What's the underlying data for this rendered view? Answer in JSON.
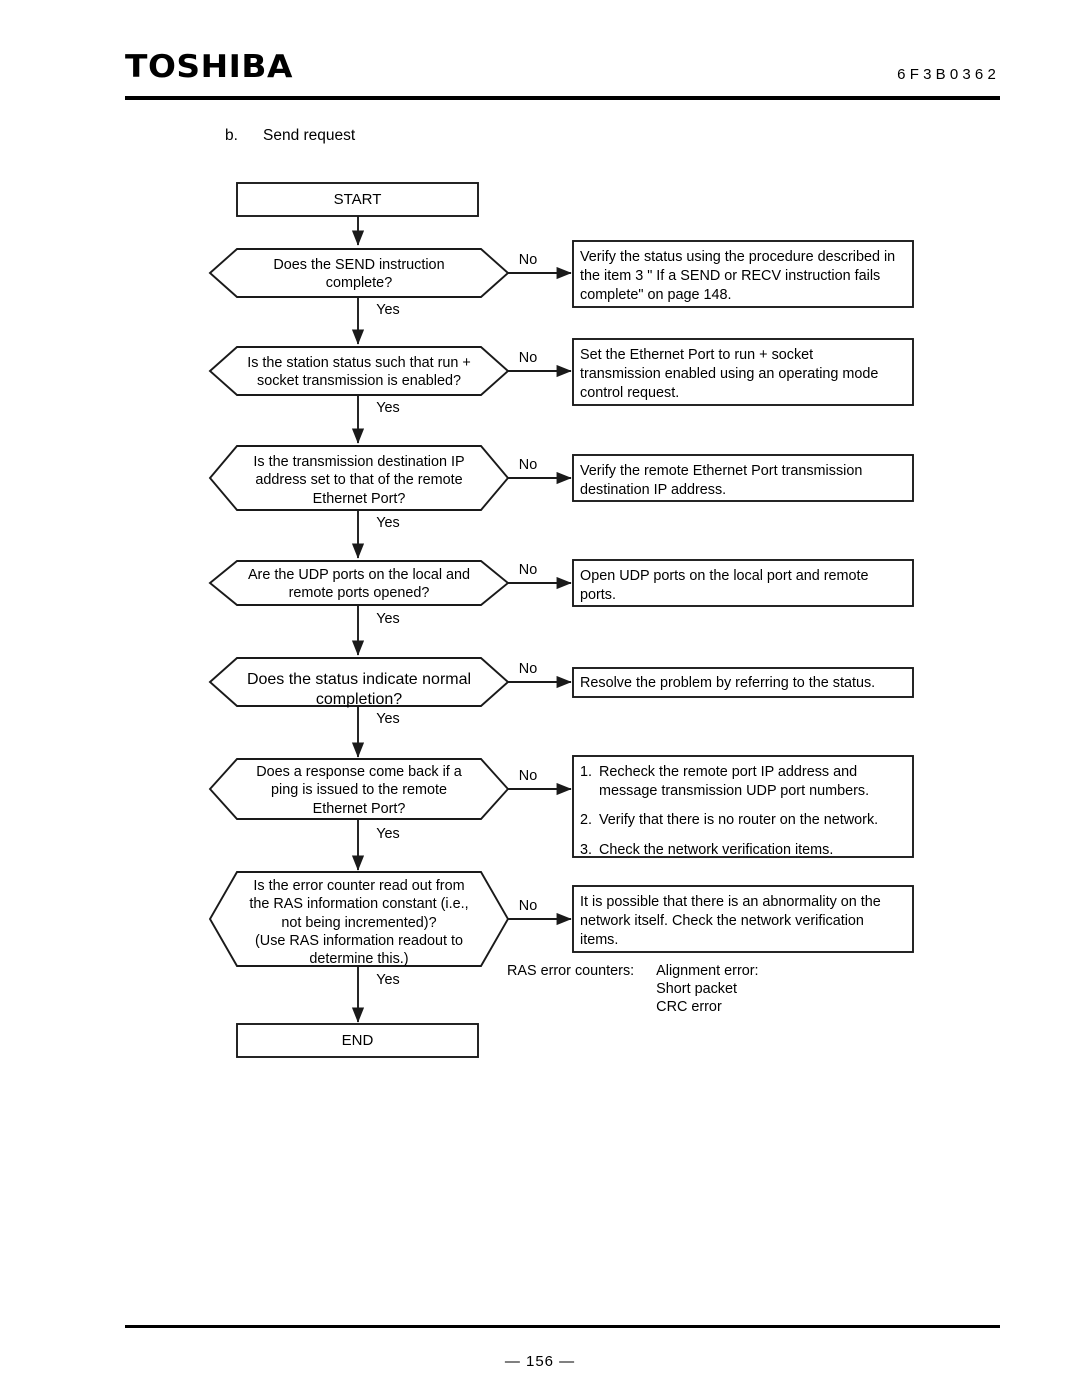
{
  "header": {
    "brand": "TOSHIBA",
    "doc_number": "6F3B0362"
  },
  "footer": {
    "page_number": "— 156 —"
  },
  "section": {
    "label": "b.",
    "title": "Send request"
  },
  "flowchart": {
    "type": "flowchart",
    "start_label": "START",
    "end_label": "END",
    "yes_label": "Yes",
    "no_label": "No",
    "steps": [
      {
        "question": "Does the SEND instruction\ncomplete?",
        "no_action": "Verify the status using the procedure described in\nthe item 3 \" If a SEND or RECV instruction fails\ncomplete\" on page 148."
      },
      {
        "question": "Is the station status such that run +\nsocket transmission is enabled?",
        "no_action": "Set the Ethernet Port to run + socket\ntransmission enabled using an operating mode\ncontrol request."
      },
      {
        "question": "Is the transmission destination IP\naddress set to that of the remote\nEthernet Port?",
        "no_action": "Verify the remote Ethernet Port transmission\ndestination IP address."
      },
      {
        "question": "Are the UDP ports on the local and\nremote ports opened?",
        "no_action": "Open UDP ports on the local port and remote\nports."
      },
      {
        "question": "Does the status indicate normal\ncompletion?",
        "no_action": "Resolve the problem by referring to the status."
      },
      {
        "question": "Does a response come back if a\nping is issued to the remote\nEthernet Port?",
        "no_action_list": [
          {
            "num": "1.",
            "text": "Recheck the remote port IP address and\nmessage transmission UDP port numbers."
          },
          {
            "num": "2.",
            "text": "Verify that there is no router on the network."
          },
          {
            "num": "3.",
            "text": "Check the network verification items."
          }
        ]
      },
      {
        "question": "Is the error counter read out from\nthe RAS information constant (i.e.,\nnot being incremented)?\n(Use RAS information readout to\ndetermine this.)",
        "no_action": "It is possible that there is an abnormality on the\nnetwork itself. Check the network verification\nitems."
      }
    ],
    "ras_note": {
      "label": "RAS error counters:",
      "values": "Alignment error:\nShort packet\nCRC error"
    }
  },
  "colors": {
    "ink": "#000000",
    "paper": "#ffffff",
    "stroke": "#1a1a1a"
  }
}
